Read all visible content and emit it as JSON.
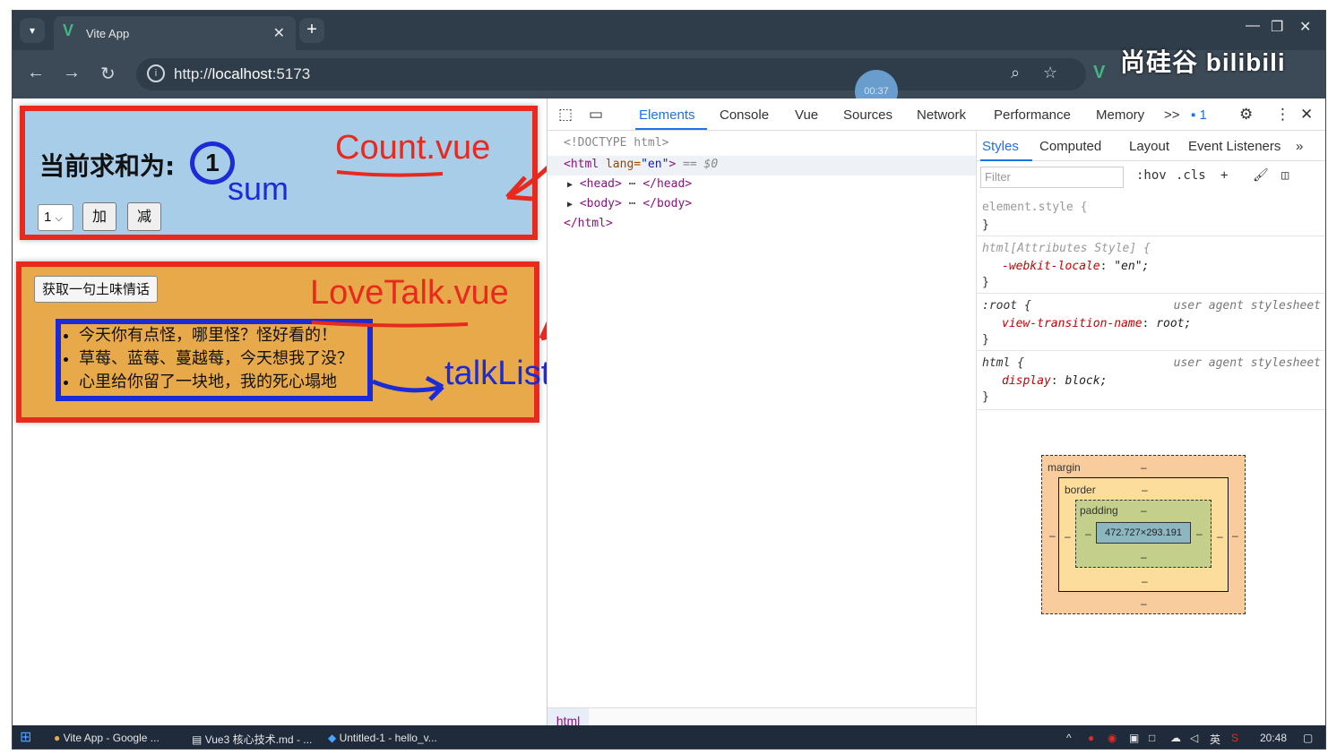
{
  "browser": {
    "tab_title": "Vite App",
    "tab_close": "✕",
    "new_tab": "+",
    "url_prefix": "http://",
    "url_host": "localhost",
    "url_port": ":5173",
    "minimize": "—",
    "restore": "❐",
    "close": "✕"
  },
  "watermark": "尚硅谷 bilibili",
  "timer": "00:37",
  "count_component": {
    "heading": "当前求和为:",
    "sum_value": "1",
    "select_value": "1",
    "add_label": "加",
    "sub_label": "减",
    "annotation_file": "Count.vue",
    "annotation_var": "sum"
  },
  "lovetalk_component": {
    "fetch_button": "获取一句土味情话",
    "talks": [
      "今天你有点怪，哪里怪？怪好看的！",
      "草莓、蓝莓、蔓越莓，今天想我了没？",
      "心里给你留了一块地，我的死心塌地"
    ],
    "annotation_file": "LoveTalk.vue",
    "annotation_var": "talkList"
  },
  "devtools": {
    "tabs": [
      "Elements",
      "Console",
      "Vue",
      "Sources",
      "Network",
      "Performance",
      "Memory"
    ],
    "more": ">>",
    "issues_count": "1",
    "dom": {
      "doctype": "<!DOCTYPE html>",
      "html_open_tag": "<html",
      "html_attr": " lang=",
      "html_attr_val": "\"en\"",
      "html_close_bracket": ">",
      "selected_marker": " == $0",
      "head": "<head>",
      "head_ellipsis": " ⋯ ",
      "head_close": "</head>",
      "body": "<body>",
      "body_ellipsis": " ⋯ ",
      "body_close": "</body>",
      "html_close": "</html>"
    },
    "breadcrumb": "html",
    "styles_tabs": [
      "Styles",
      "Computed",
      "Layout",
      "Event Listeners"
    ],
    "filter_placeholder": "Filter",
    "hov": ":hov",
    "cls": ".cls",
    "rules": {
      "element_style": "element.style {",
      "attr_style_selector": "html[Attributes Style] {",
      "webkit_prop": "-webkit-locale",
      "webkit_val": "\"en\";",
      "root_selector": ":root {",
      "root_source": "user agent stylesheet",
      "vt_prop": "view-transition-name",
      "vt_val": "root;",
      "html_selector": "html {",
      "html_source": "user agent stylesheet",
      "display_prop": "display",
      "display_val": "block;",
      "close_brace": "}"
    },
    "box_model": {
      "margin_label": "margin",
      "border_label": "border",
      "padding_label": "padding",
      "content_size": "472.727×293.191",
      "dash": "–"
    }
  },
  "taskbar": {
    "items": [
      "Vite App - Google ...",
      "Vue3 核心技术.md - ...",
      "Untitled-1 - hello_v..."
    ],
    "ime": "英",
    "time": "20:48"
  },
  "colors": {
    "count_bg": "#a7cde9",
    "lovetalk_bg": "#e8a94a",
    "annotation_red": "#e8291d",
    "annotation_blue": "#1b2bd6",
    "devtools_accent": "#1a73e8"
  }
}
